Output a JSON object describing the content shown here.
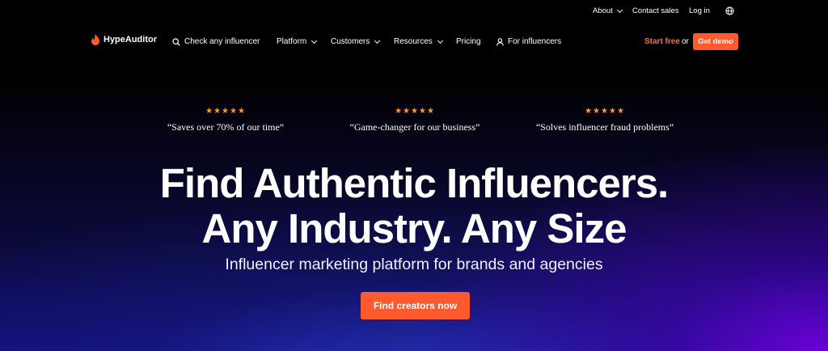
{
  "utility_bar": {
    "about": "About",
    "contact_sales": "Contact sales",
    "log_in": "Log in"
  },
  "nav": {
    "brand": "HypeAuditor",
    "check_influencer": "Check any influencer",
    "platform": "Platform",
    "customers": "Customers",
    "resources": "Resources",
    "pricing": "Pricing",
    "for_influencers": "For influencers",
    "start_free": "Start free",
    "or": "or",
    "get_demo": "Get demo"
  },
  "reviews": [
    {
      "stars": "★★★★★",
      "quote": "“Saves over 70% of our time”"
    },
    {
      "stars": "★★★★★",
      "quote": "“Game-changer for our business”"
    },
    {
      "stars": "★★★★★",
      "quote": "“Solves influencer fraud problems”"
    }
  ],
  "hero": {
    "headline_line1": "Find Authentic Influencers.",
    "headline_line2": "Any Industry. Any Size",
    "subheadline": "Influencer marketing platform for brands and agencies",
    "cta": "Find creators now"
  },
  "colors": {
    "accent": "#ff5a2e",
    "star": "#ff9a2e",
    "background": "#000000",
    "gradient_purple": "#6e00dc"
  },
  "icons": [
    "flame-logo-icon",
    "search-icon",
    "chevron-down-icon",
    "user-icon",
    "globe-icon"
  ]
}
